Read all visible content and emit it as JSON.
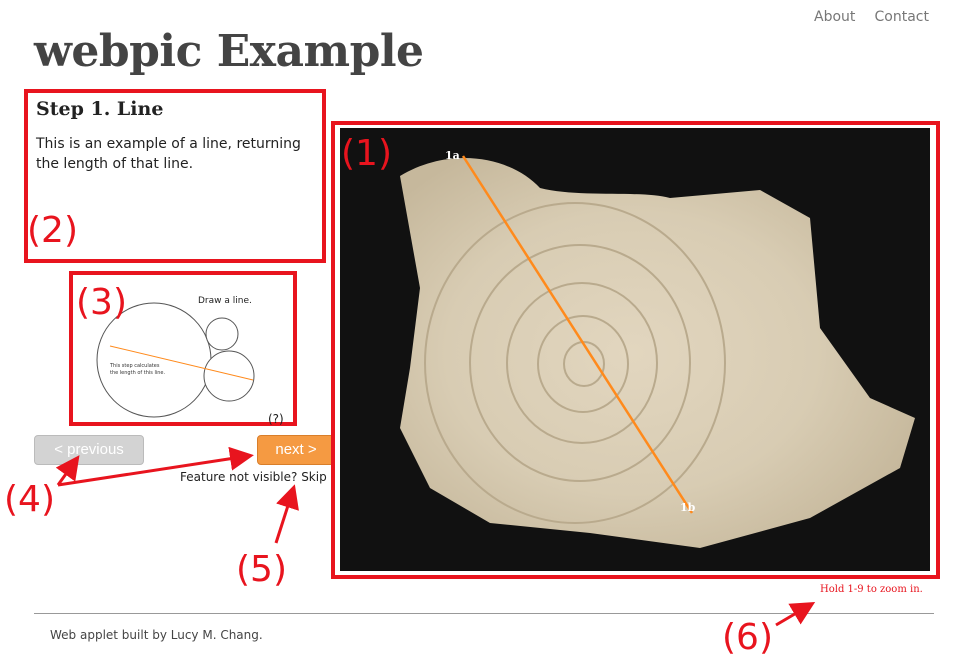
{
  "nav": {
    "about": "About",
    "contact": "Contact"
  },
  "site_title": "webpic Example",
  "step": {
    "title": "Step 1. Line",
    "description": "This is an example of a line, returning the length of that line."
  },
  "diagram": {
    "heading": "Draw a line.",
    "caption_line1": "This step calculates",
    "caption_line2": "the length of this line."
  },
  "help_marker": "(?)",
  "buttons": {
    "previous": "< previous",
    "next": "next >"
  },
  "skip": {
    "prefix": "Feature not visible?",
    "link": "Skip it"
  },
  "image_points": {
    "start": "1a",
    "end": "1b"
  },
  "zoom_hint": "Hold 1-9 to zoom in.",
  "footer": "Web applet built by Lucy M. Chang.",
  "annotations": [
    "(1)",
    "(2)",
    "(3)",
    "(4)",
    "(5)",
    "(6)"
  ],
  "colors": {
    "annotation_red": "#e8141e",
    "next_orange": "#f59a42",
    "line_orange": "#ff8a1c"
  }
}
